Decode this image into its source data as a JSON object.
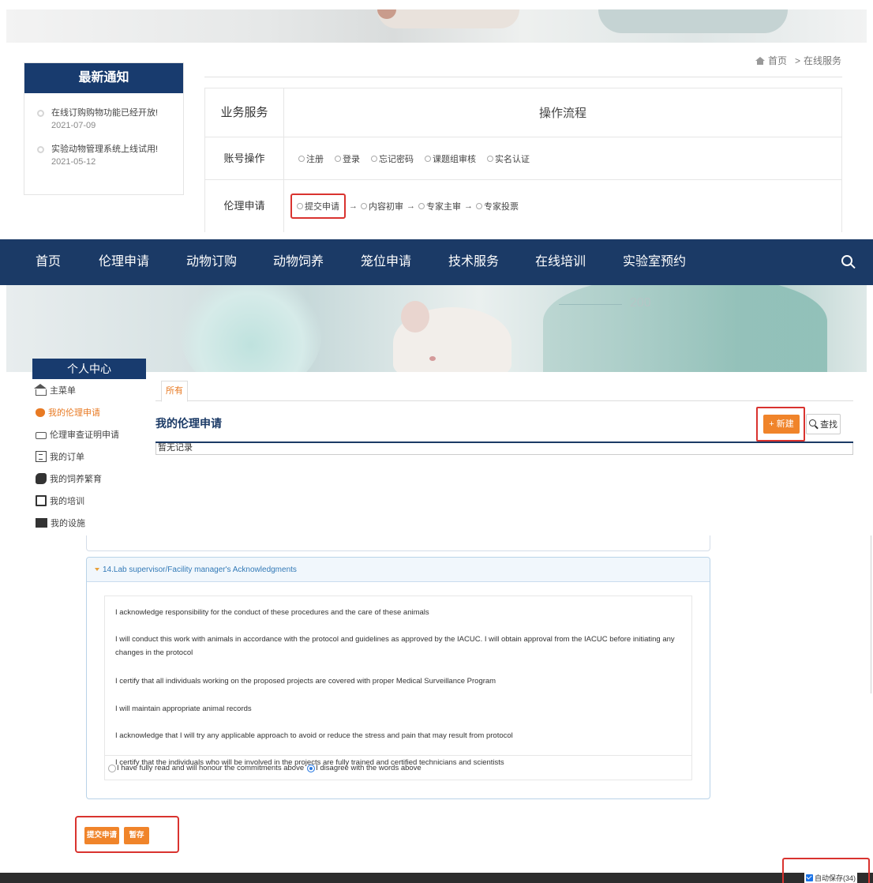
{
  "notice_panel": {
    "title": "最新通知",
    "items": [
      {
        "title": "在线订购购物功能已经开放!",
        "date": "2021-07-09"
      },
      {
        "title": "实验动物管理系统上线试用!",
        "date": "2021-05-12"
      }
    ]
  },
  "breadcrumb": {
    "home": "首页",
    "separator": ">",
    "current": "在线服务"
  },
  "flow_table": {
    "header": {
      "col1": "业务服务",
      "col2": "操作流程"
    },
    "account_row": {
      "label": "账号操作",
      "steps": [
        "注册",
        "登录",
        "忘记密码",
        "课题组审核",
        "实名认证"
      ]
    },
    "ethics_row": {
      "label": "伦理申请",
      "steps": [
        "提交申请",
        "内容初审",
        "专家主审",
        "专家投票"
      ],
      "arrow": "→"
    }
  },
  "topnav": {
    "items": [
      "首页",
      "伦理申请",
      "动物订购",
      "动物饲养",
      "笼位申请",
      "技术服务",
      "在线培训",
      "实验室预约"
    ]
  },
  "hero": {
    "scale_text": "200"
  },
  "personal_center": {
    "title": "个人中心",
    "items": [
      {
        "label": "主菜单",
        "icon": "home-icon"
      },
      {
        "label": "我的伦理申请",
        "icon": "heart-icon",
        "active": true
      },
      {
        "label": "伦理审查证明申请",
        "icon": "printer-icon"
      },
      {
        "label": "我的订单",
        "icon": "list-icon"
      },
      {
        "label": "我的饲养繁育",
        "icon": "animal-icon"
      },
      {
        "label": "我的培训",
        "icon": "training-icon"
      },
      {
        "label": "我的设施",
        "icon": "building-icon"
      }
    ]
  },
  "ethics_list": {
    "tab_all": "所有",
    "title": "我的伦理申请",
    "new_button": "+ 新建",
    "find_button": "查找",
    "empty_text": "暂无记录"
  },
  "acknowledgment": {
    "section_title": "14.Lab supervisor/Facility manager's Acknowledgments",
    "lines": [
      "I acknowledge responsibility for the conduct of these procedures and the care of these animals",
      "I will conduct this work with animals in accordance with the protocol and guidelines as approved by the IACUC. I will obtain approval from the IACUC before initiating any changes in the protocol",
      "I certify that all individuals working on the proposed projects are covered with proper Medical Surveillance Program",
      "I will maintain appropriate animal records",
      "I acknowledge that I will try any applicable approach to avoid or reduce the stress and pain that may result from protocol",
      "I certify that the individuals who will be involved in the projects are fully trained and certified technicians and scientists"
    ],
    "option_agree": "I have fully read and will honour the commitments above",
    "option_disagree": "I disagree with the words above",
    "selected": "disagree"
  },
  "form_buttons": {
    "submit": "提交申请",
    "save_draft": "暂存"
  },
  "autosave": {
    "label": "自动保存(34)",
    "checked": true
  },
  "colors": {
    "navy": "#1b3a66",
    "orange": "#f0842a",
    "highlight_red": "#d9332f",
    "link_blue": "#337ab7"
  }
}
